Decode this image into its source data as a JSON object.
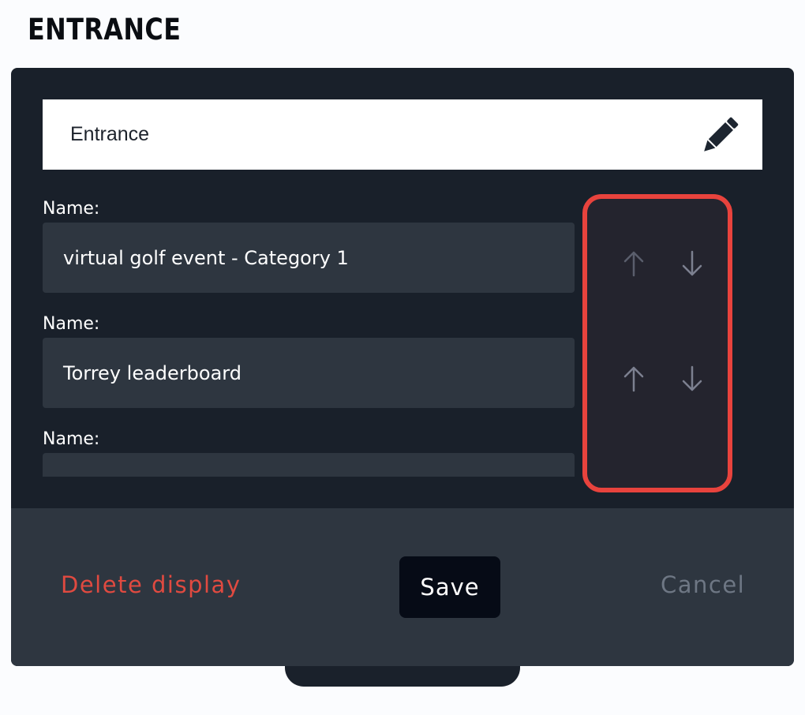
{
  "page": {
    "title": "ENTRANCE"
  },
  "modal": {
    "header_value": "Entrance",
    "fields": [
      {
        "label": "Name:",
        "value": "virtual golf event - Category 1"
      },
      {
        "label": "Name:",
        "value": "Torrey leaderboard"
      },
      {
        "label": "Name:",
        "value": ""
      }
    ],
    "footer": {
      "delete_label": "Delete display",
      "save_label": "Save",
      "cancel_label": "Cancel"
    }
  },
  "colors": {
    "panel_bg": "#19202a",
    "input_bg": "#2e3640",
    "highlight_border": "#e8433d",
    "delete_text": "#e04a40",
    "cancel_text": "#6e7784",
    "arrow_dim": "#5a5e6c",
    "arrow_normal": "#7c8090"
  },
  "icons": [
    "pencil-icon",
    "arrow-up-icon",
    "arrow-down-icon"
  ]
}
